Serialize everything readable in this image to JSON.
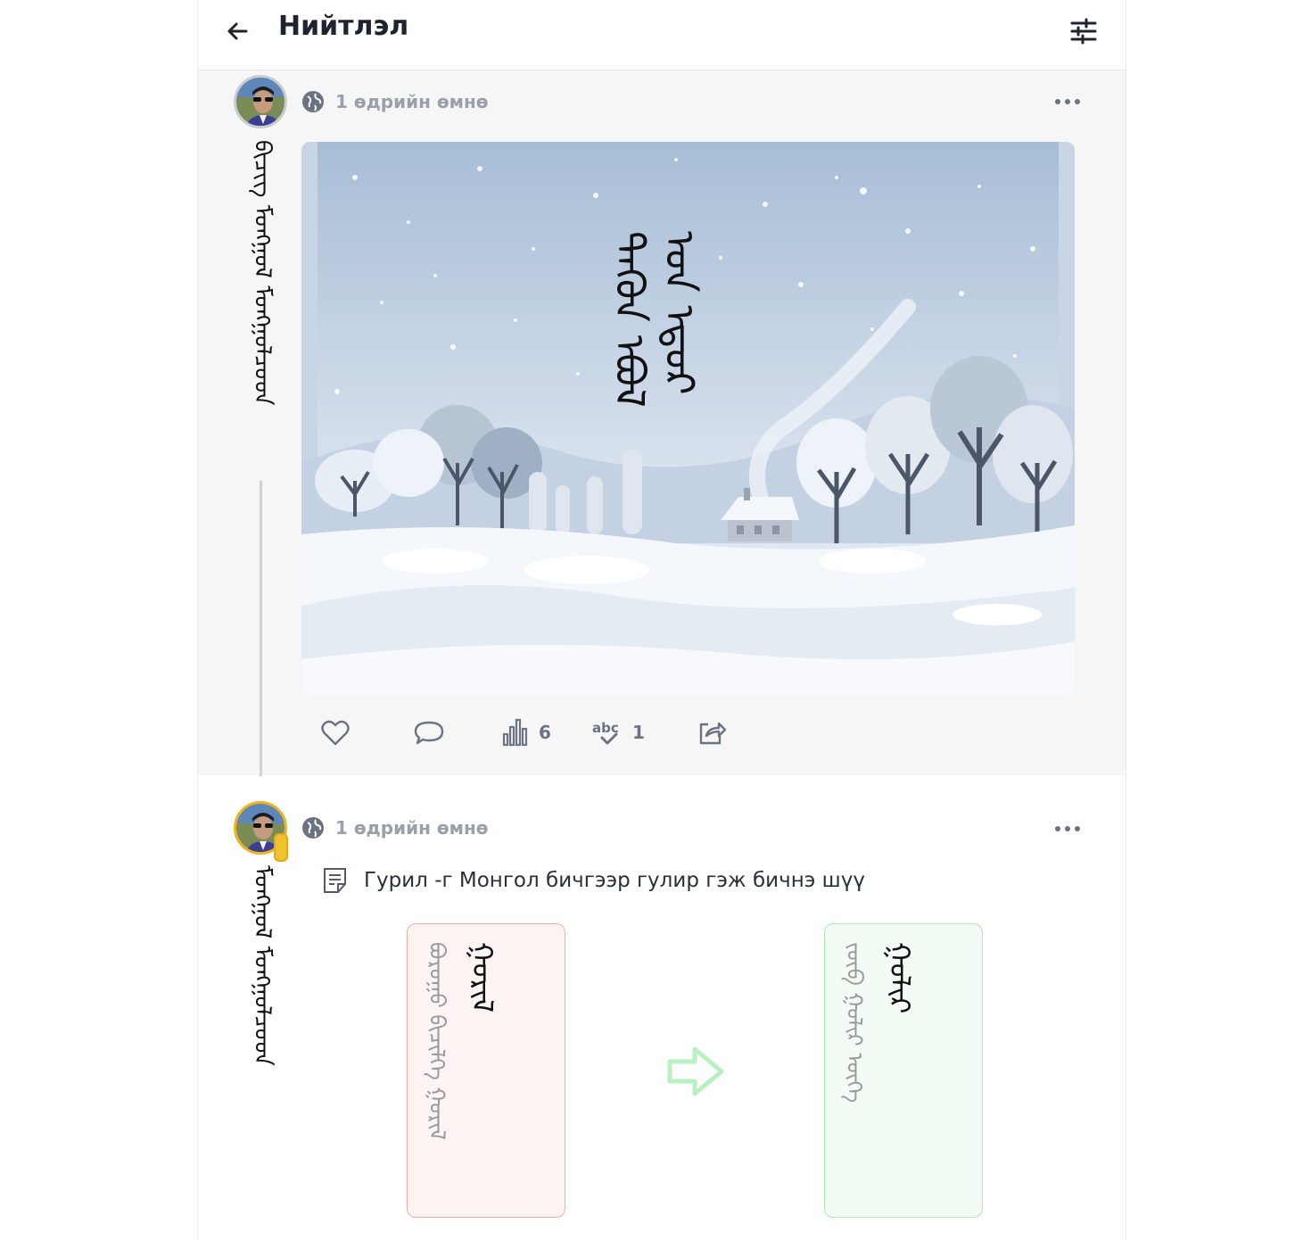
{
  "header": {
    "title": "Нийтлэл",
    "back_icon": "arrow-left-icon",
    "filter_icon": "sliders-icon"
  },
  "posts": [
    {
      "time": "1 өдрийн өмнө",
      "author_script": "ᠪᠢᠴᠢᠭ ᠮᠣᠩᠭᠣᠯ ᠮᠣᠩᠭᠣᠯᠴᠤᠳ",
      "image_caption": "ᠲᠡᠭᠦᠨ ᠡᠪᠦᠯ ᠤᠨ ᠡᠳᠦᠷ",
      "actions": {
        "like_icon": "heart-icon",
        "comment_icon": "comment-icon",
        "views_icon": "bar-chart-icon",
        "views_count": "6",
        "spellcheck_icon": "spellcheck-icon",
        "spellcheck_count": "1",
        "share_icon": "share-icon"
      }
    },
    {
      "time": "1 өдрийн өмнө",
      "author_script": "ᠮᠣᠩᠭᠣᠯ ᠮᠣᠩᠭᠣᠯᠴᠤᠳ",
      "edit_icon": "edit-note-icon",
      "note": "Гурил -г Монгол бичгээр гулир гэж бичнэ шүү",
      "before": {
        "word": "ᠭᠤᠷᠢᠯ",
        "faded": "ᠪᠤᠷᠤᠭᠤ ᠪᠢᠴᠢᠯᠭᠡ ᠭᠤᠷᠢᠯ"
      },
      "after": {
        "word": "ᠭᠤᠯᠢᠷ",
        "faded": "ᠵᠥᠪ ᠭᠤᠯᠢᠷ ᠦᠭᠡ"
      }
    }
  ],
  "colors": {
    "accent_red_border": "#f3a9a9",
    "accent_green_border": "#aee8b5",
    "gold_avatar_border": "#f0b31d"
  }
}
